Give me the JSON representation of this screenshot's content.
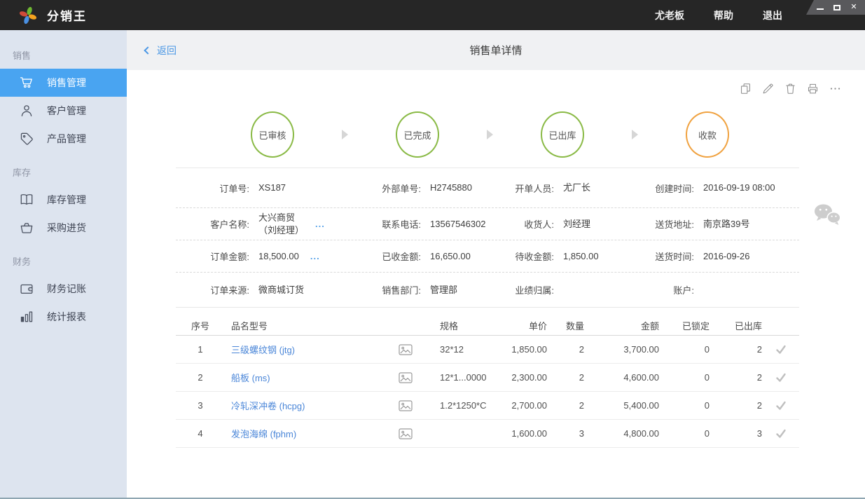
{
  "colors": {
    "titlebar_bg": "#262626",
    "sidebar_bg": "#dde4ef",
    "sidebar_active_bg": "#49a4f1",
    "accent_blue": "#4a97e5",
    "link_blue": "#4a86d8",
    "step_green": "#8aba46",
    "step_orange": "#f0a240"
  },
  "titlebar": {
    "app_title": "分销王",
    "menu": {
      "user": "尤老板",
      "help": "帮助",
      "logout": "退出"
    },
    "window_controls": [
      "minimize",
      "maximize",
      "close"
    ]
  },
  "sidebar": {
    "sections": [
      {
        "label": "销售",
        "items": [
          {
            "icon": "cart-icon",
            "label": "销售管理",
            "active": true
          },
          {
            "icon": "person-icon",
            "label": "客户管理",
            "active": false
          },
          {
            "icon": "tag-icon",
            "label": "产品管理",
            "active": false
          }
        ]
      },
      {
        "label": "库存",
        "items": [
          {
            "icon": "book-icon",
            "label": "库存管理",
            "active": false
          },
          {
            "icon": "basket-icon",
            "label": "采购进货",
            "active": false
          }
        ]
      },
      {
        "label": "财务",
        "items": [
          {
            "icon": "wallet-icon",
            "label": "财务记账",
            "active": false
          },
          {
            "icon": "bar-chart-icon",
            "label": "统计报表",
            "active": false
          }
        ]
      }
    ]
  },
  "header": {
    "back_label": "返回",
    "page_title": "销售单详情"
  },
  "toolbar": {
    "icons": [
      "duplicate",
      "edit",
      "delete",
      "print",
      "more"
    ]
  },
  "status_flow": {
    "steps": [
      {
        "label": "已审核",
        "color": "green"
      },
      {
        "label": "已完成",
        "color": "green"
      },
      {
        "label": "已出库",
        "color": "green"
      },
      {
        "label": "收款",
        "color": "orange"
      }
    ]
  },
  "order_info": {
    "rows": [
      [
        {
          "label": "订单号:",
          "value": "XS187"
        },
        {
          "label": "外部单号:",
          "value": "H2745880"
        },
        {
          "label": "开单人员:",
          "value": "尤厂长"
        },
        {
          "label": "创建时间:",
          "value": "2016-09-19 08:00"
        }
      ],
      [
        {
          "label": "客户名称:",
          "value": "大兴商贸\n（刘经理）",
          "more": "..."
        },
        {
          "label": "联系电话:",
          "value": "13567546302"
        },
        {
          "label": "收货人:",
          "value": "刘经理"
        },
        {
          "label": "送货地址:",
          "value": "南京路39号"
        }
      ],
      [
        {
          "label": "订单金额:",
          "value": "18,500.00",
          "more": "..."
        },
        {
          "label": "已收金额:",
          "value": "16,650.00"
        },
        {
          "label": "待收金额:",
          "value": "1,850.00"
        },
        {
          "label": "送货时间:",
          "value": "2016-09-26"
        }
      ],
      [
        {
          "label": "订单来源:",
          "value": "微商城订货"
        },
        {
          "label": "销售部门:",
          "value": "管理部"
        },
        {
          "label": "业绩归属:",
          "value": ""
        },
        {
          "label": "账户:",
          "value": ""
        }
      ]
    ]
  },
  "items_table": {
    "columns": {
      "seq": "序号",
      "name": "品名型号",
      "spec": "规格",
      "price": "单价",
      "qty": "数量",
      "amount": "金额",
      "locked": "已锁定",
      "shipped": "已出库"
    },
    "rows": [
      {
        "seq": "1",
        "name": "三级螺纹钢 (jtg)",
        "spec": "32*12",
        "price": "1,850.00",
        "qty": "2",
        "amount": "3,700.00",
        "locked": "0",
        "shipped": "2"
      },
      {
        "seq": "2",
        "name": "船板 (ms)",
        "spec": "12*1...0000",
        "price": "2,300.00",
        "qty": "2",
        "amount": "4,600.00",
        "locked": "0",
        "shipped": "2"
      },
      {
        "seq": "3",
        "name": "冷轧深冲卷 (hcpg)",
        "spec": "1.2*1250*C",
        "price": "2,700.00",
        "qty": "2",
        "amount": "5,400.00",
        "locked": "0",
        "shipped": "2"
      },
      {
        "seq": "4",
        "name": "发泡海绵 (fphm)",
        "spec": "",
        "price": "1,600.00",
        "qty": "3",
        "amount": "4,800.00",
        "locked": "0",
        "shipped": "3"
      }
    ]
  }
}
